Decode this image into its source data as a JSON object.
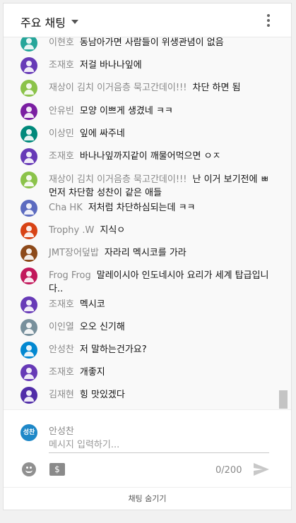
{
  "header": {
    "title": "주요 채팅",
    "dropdown_icon": "caret-down-icon",
    "menu_icon": "more-vert-icon"
  },
  "messages": [
    {
      "author": "이현호",
      "text": "동남아가면 사람들이 위생관념이 없음",
      "avatar_color": "#26a69a"
    },
    {
      "author": "조재호",
      "text": "저걸 바나나잎에",
      "avatar_color": "#673ab7"
    },
    {
      "author": "재상이 김치 이거음층 묵고간데이!!!",
      "text": "차단 하면 됨",
      "avatar_color": "#8bc34a"
    },
    {
      "author": "안유빈",
      "text": "모양 이쁘게 생겼네 ㅋㅋ",
      "avatar_color": "#7b1fa2"
    },
    {
      "author": "이상민",
      "text": "잎에 싸주네",
      "avatar_color": "#00897b"
    },
    {
      "author": "조재호",
      "text": "바나나잎까지같이 깨물어먹으면 ㅇㅈ",
      "avatar_color": "#673ab7"
    },
    {
      "author": "재상이 김치 이거음층 묵고간데이!!!",
      "text": "난 이거 보기전에 ㅃ먼저 차단함 성찬이 같은 애들",
      "avatar_color": "#8bc34a"
    },
    {
      "author": "Cha HK",
      "text": "저처럼 차단하심되는데 ㅋㅋ",
      "avatar_color": "#5c6bc0"
    },
    {
      "author": "Trophy .W",
      "text": "지식ㅇ",
      "avatar_color": "#d84315"
    },
    {
      "author": "JMT장어덮밥",
      "text": "자라리 멕시코를 가라",
      "avatar_color": "#8d4a1a"
    },
    {
      "author": "Frog Frog",
      "text": "말레이시아 인도네시아 요리가 세계 탑급입니다..",
      "avatar_color": "#c2185b"
    },
    {
      "author": "조재호",
      "text": "멕시코",
      "avatar_color": "#673ab7"
    },
    {
      "author": "이인열",
      "text": "오오 신기해",
      "avatar_color": "#78909c"
    },
    {
      "author": "안성찬",
      "text": "저 말하는건가요?",
      "avatar_color": "#0288d1"
    },
    {
      "author": "조재호",
      "text": "개좋지",
      "avatar_color": "#673ab7"
    },
    {
      "author": "김재현",
      "text": "힝 맛있겠다",
      "avatar_color": "#512da8"
    }
  ],
  "input": {
    "avatar_text": "성찬",
    "user_name": "안성찬",
    "placeholder": "메시지 입력하기...",
    "char_count": "0/200",
    "emoji_icon": "emoji-icon",
    "super_chat_icon": "super-chat-icon",
    "send_icon": "send-icon"
  },
  "footer": {
    "hide_chat": "채팅 숨기기"
  }
}
